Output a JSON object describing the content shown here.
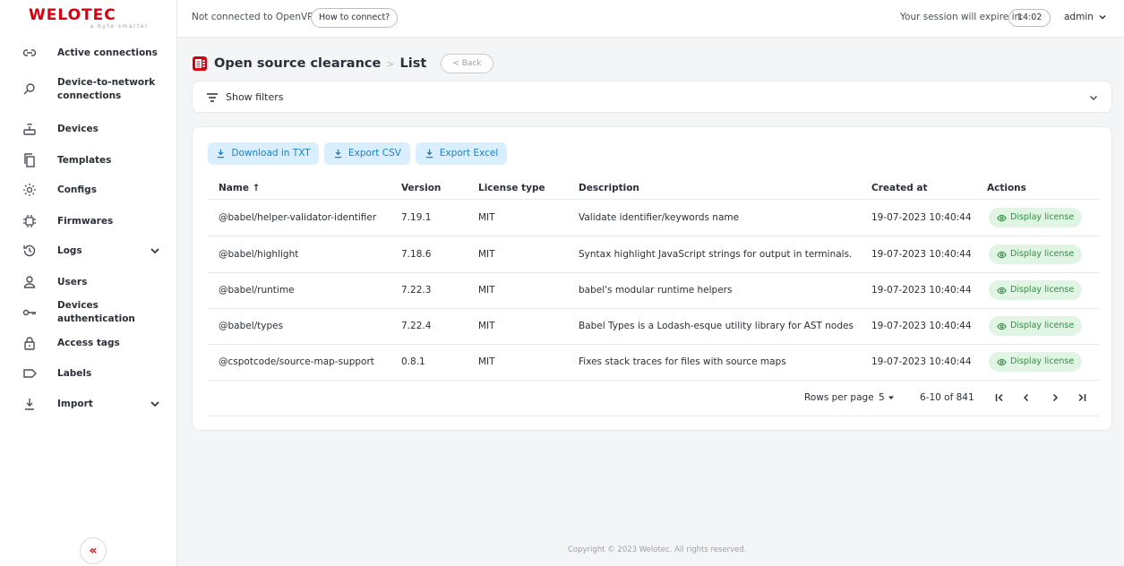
{
  "brand": {
    "logo_text": "WELOTEC",
    "tagline": "a byte smarter",
    "accent_color": "#d7000f"
  },
  "topbar": {
    "vpn_status": "Not connected to OpenVPN",
    "vpn_button": "How to connect?",
    "session_label": "Your session will expire in:",
    "session_time": "14:02",
    "user": "admin"
  },
  "sidebar": {
    "items": [
      {
        "label": "Active connections",
        "icon": "link-icon"
      },
      {
        "label": "Device-to-network connections",
        "icon": "network-search-icon"
      },
      {
        "label": "Devices",
        "icon": "router-icon"
      },
      {
        "label": "Templates",
        "icon": "copy-icon"
      },
      {
        "label": "Configs",
        "icon": "gear-icon"
      },
      {
        "label": "Firmwares",
        "icon": "chip-icon"
      },
      {
        "label": "Logs",
        "icon": "history-icon",
        "expandable": true
      },
      {
        "label": "Users",
        "icon": "user-icon"
      },
      {
        "label": "Devices authentication",
        "icon": "key-icon"
      },
      {
        "label": "Access tags",
        "icon": "lock-icon"
      },
      {
        "label": "Labels",
        "icon": "label-icon"
      },
      {
        "label": "Import",
        "icon": "download-icon",
        "expandable": true
      }
    ],
    "collapse_label": "«"
  },
  "header": {
    "title": "Open source clearance",
    "separator": ">",
    "crumb": "List",
    "back_label": "< Back"
  },
  "filters": {
    "label": "Show filters"
  },
  "exports": [
    {
      "label": "Download in TXT"
    },
    {
      "label": "Export CSV"
    },
    {
      "label": "Export Excel"
    }
  ],
  "table": {
    "columns": [
      "Name ↑",
      "Version",
      "License type",
      "Description",
      "Created at",
      "Actions"
    ],
    "rows": [
      {
        "name": "@babel/helper-validator-identifier",
        "version": "7.19.1",
        "license": "MIT",
        "description": "Validate identifier/keywords name",
        "created": "19-07-2023 10:40:44",
        "action": "Display license"
      },
      {
        "name": "@babel/highlight",
        "version": "7.18.6",
        "license": "MIT",
        "description": "Syntax highlight JavaScript strings for output in terminals.",
        "created": "19-07-2023 10:40:44",
        "action": "Display license"
      },
      {
        "name": "@babel/runtime",
        "version": "7.22.3",
        "license": "MIT",
        "description": "babel's modular runtime helpers",
        "created": "19-07-2023 10:40:44",
        "action": "Display license"
      },
      {
        "name": "@babel/types",
        "version": "7.22.4",
        "license": "MIT",
        "description": "Babel Types is a Lodash-esque utility library for AST nodes",
        "created": "19-07-2023 10:40:44",
        "action": "Display license"
      },
      {
        "name": "@cspotcode/source-map-support",
        "version": "0.8.1",
        "license": "MIT",
        "description": "Fixes stack traces for files with source maps",
        "created": "19-07-2023 10:40:44",
        "action": "Display license"
      }
    ]
  },
  "pagination": {
    "rows_per_page_label": "Rows per page",
    "rows_per_page": "5",
    "range": "6-10 of 841"
  },
  "footer": {
    "copyright": "Copyright © 2023 Welotec. All rights reserved."
  }
}
